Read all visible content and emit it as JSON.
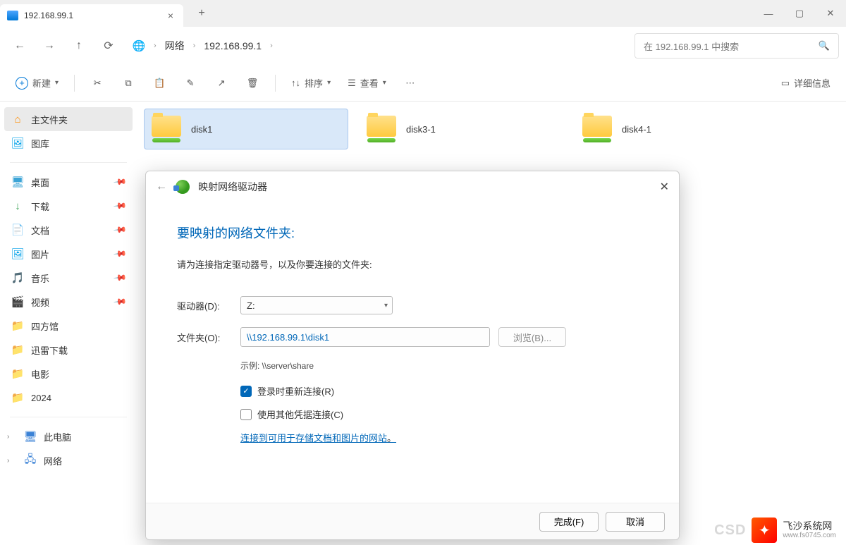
{
  "tab": {
    "title": "192.168.99.1"
  },
  "address": {
    "root": "网络",
    "host": "192.168.99.1"
  },
  "search": {
    "placeholder": "在 192.168.99.1 中搜索"
  },
  "toolbar": {
    "new": "新建",
    "sort": "排序",
    "view": "查看",
    "details": "详细信息"
  },
  "sidebar": {
    "home": "主文件夹",
    "gallery": "图库",
    "desktop": "桌面",
    "downloads": "下载",
    "documents": "文档",
    "pictures": "图片",
    "music": "音乐",
    "videos": "视频",
    "f1": "四方馆",
    "f2": "迅雷下载",
    "f3": "电影",
    "f4": "2024",
    "thispc": "此电脑",
    "network": "网络"
  },
  "folders": [
    "disk1",
    "disk3-1",
    "disk4-1"
  ],
  "dialog": {
    "wintitle": "映射网络驱动器",
    "heading": "要映射的网络文件夹:",
    "sub": "请为连接指定驱动器号，以及你要连接的文件夹:",
    "drive_label": "驱动器(D):",
    "drive_value": "Z:",
    "folder_label": "文件夹(O):",
    "folder_value": "\\\\192.168.99.1\\disk1",
    "browse": "浏览(B)...",
    "example": "示例: \\\\server\\share",
    "reconnect": "登录时重新连接(R)",
    "credentials": "使用其他凭据连接(C)",
    "link": "连接到可用于存储文档和图片的网站",
    "link_period": "。",
    "finish": "完成(F)",
    "cancel": "取消"
  },
  "watermark": {
    "csdn": "CSD",
    "name": "飞沙系统网",
    "url": "www.fs0745.com"
  }
}
